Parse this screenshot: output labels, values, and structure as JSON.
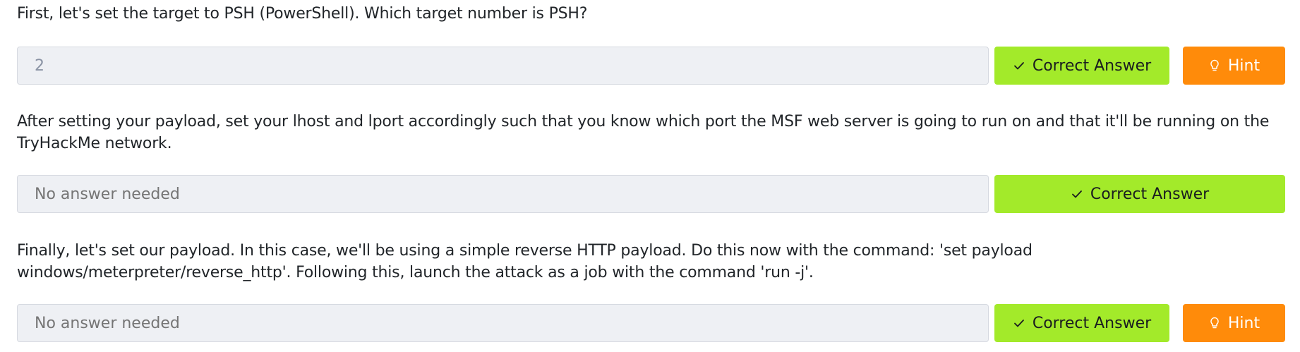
{
  "tasks": [
    {
      "question": "First, let's set the target to PSH (PowerShell). Which target number is PSH?",
      "answer_value": "2",
      "correct_label": "Correct Answer",
      "hint_label": "Hint"
    },
    {
      "question": "After setting your payload, set your lhost and lport accordingly such that you know which port the MSF web server is going to run on and that it'll be running on the TryHackMe network.",
      "answer_placeholder": "No answer needed",
      "correct_label": "Correct Answer"
    },
    {
      "question": "Finally, let's set our payload. In this case, we'll be using a simple reverse HTTP payload. Do this now with the command: 'set payload windows/meterpreter/reverse_http'. Following this, launch the attack as a job with the command 'run -j'.",
      "answer_placeholder": "No answer needed",
      "correct_label": "Correct Answer",
      "hint_label": "Hint"
    }
  ],
  "colors": {
    "correct": "#a3ea2a",
    "hint": "#ff8b0a",
    "input_bg": "#eef0f4"
  },
  "icons": {
    "correct": "check-icon",
    "hint": "lightbulb-icon"
  }
}
